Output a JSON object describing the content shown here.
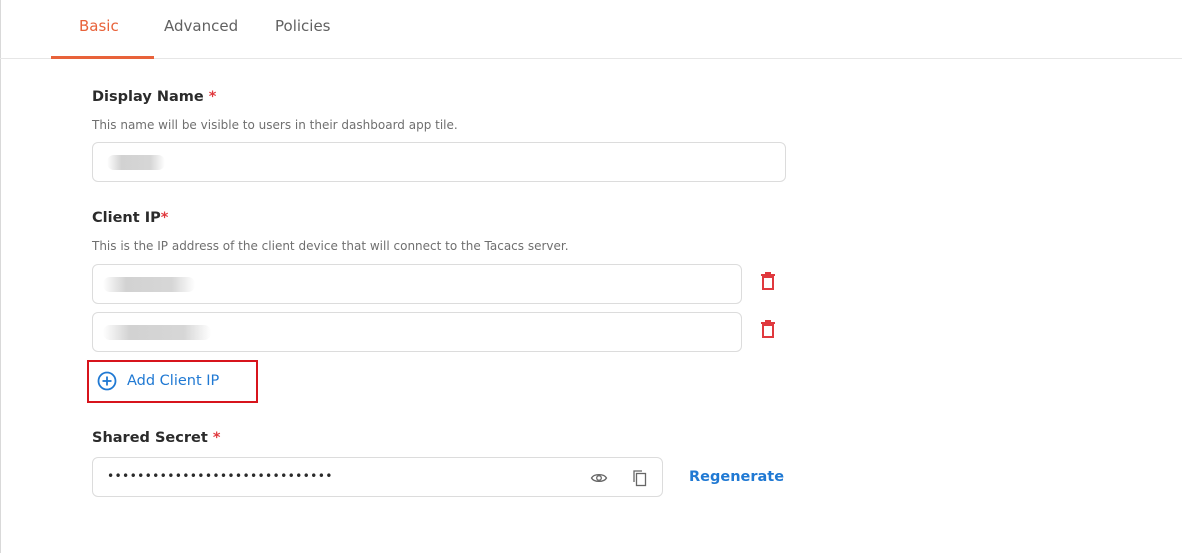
{
  "tabs": [
    {
      "label": "Basic",
      "active": true
    },
    {
      "label": "Advanced",
      "active": false
    },
    {
      "label": "Policies",
      "active": false
    }
  ],
  "display_name": {
    "label": "Display Name",
    "required_mark": "*",
    "help": "This name will be visible to users in their dashboard app tile.",
    "value": ""
  },
  "client_ip": {
    "label": "Client IP",
    "required_mark": "*",
    "help": "This is the IP address of the client device that will connect to the Tacacs server.",
    "entries": [
      "",
      ""
    ],
    "add_label": "Add Client IP"
  },
  "shared_secret": {
    "label": "Shared Secret",
    "required_mark": "*",
    "value": "••••••••••••••••••••••••••••••",
    "regenerate_label": "Regenerate"
  },
  "icons": {
    "delete": "trash-icon",
    "add": "plus-circle-icon",
    "reveal": "eye-icon",
    "copy": "copy-icon"
  },
  "colors": {
    "accent": "#e8623a",
    "link": "#2079d3",
    "required": "#e0393e",
    "delete": "#e0393e",
    "highlight_box": "#d7141c"
  }
}
